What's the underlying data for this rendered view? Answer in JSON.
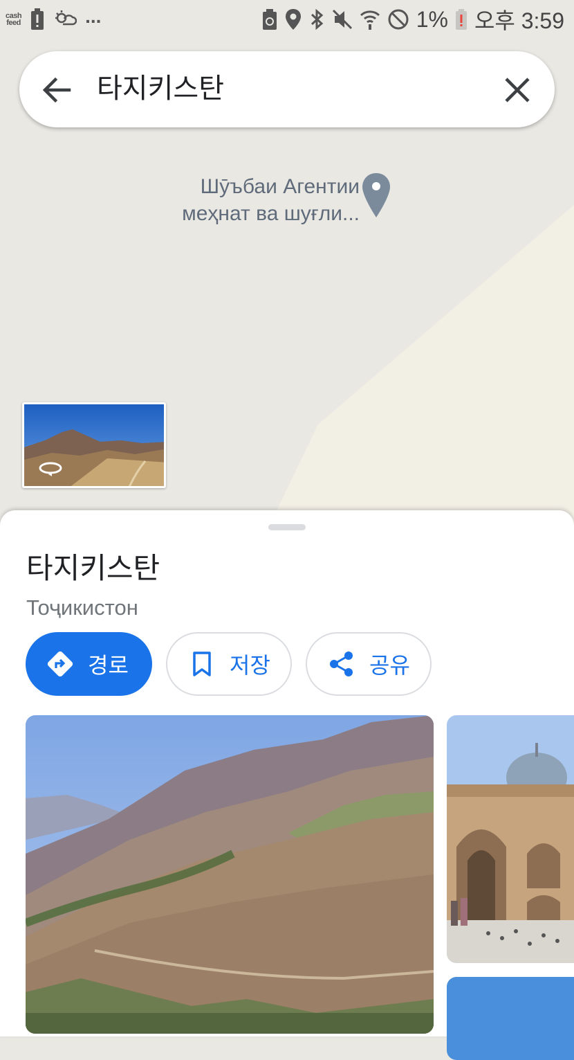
{
  "status_bar": {
    "app_badge": "cash feed",
    "battery_percent": "1%",
    "time": "오후 3:59",
    "more": "..."
  },
  "search": {
    "query": "타지키스탄"
  },
  "map": {
    "poi_label": "Шӯъбаи Агентии меҳнат ва шуғли..."
  },
  "place": {
    "title": "타지키스탄",
    "subtitle": "Тоҷикистон"
  },
  "actions": {
    "directions": "경로",
    "save": "저장",
    "share": "공유"
  },
  "colors": {
    "accent": "#1a73e8",
    "map_bg": "#eae8e3",
    "map_land": "#f2efe5"
  }
}
